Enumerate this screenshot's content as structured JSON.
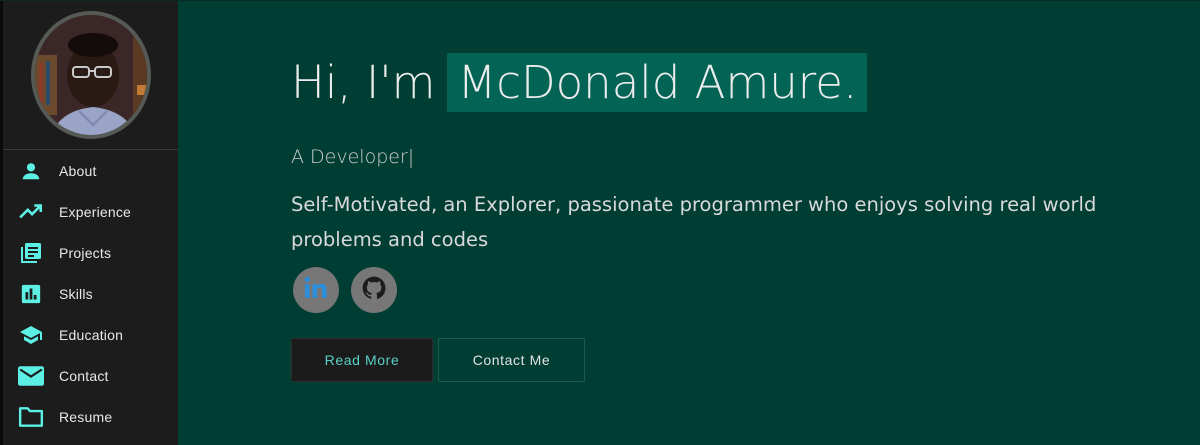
{
  "sidebar": {
    "avatar_alt": "",
    "items": [
      {
        "label": "About",
        "icon": "person-icon"
      },
      {
        "label": "Experience",
        "icon": "trending-up-icon"
      },
      {
        "label": "Projects",
        "icon": "library-books-icon"
      },
      {
        "label": "Skills",
        "icon": "bar-chart-icon"
      },
      {
        "label": "Education",
        "icon": "school-icon"
      },
      {
        "label": "Contact",
        "icon": "mail-icon"
      },
      {
        "label": "Resume",
        "icon": "folder-icon"
      }
    ]
  },
  "hero": {
    "greeting": "Hi, I'm",
    "name": "McDonald Amure.",
    "role": "A Developer|",
    "tagline": "Self-Motivated, an Explorer, passionate programmer who enjoys solving real world problems and codes"
  },
  "socials": [
    {
      "name": "linkedin",
      "icon": "linkedin-icon"
    },
    {
      "name": "github",
      "icon": "github-icon"
    }
  ],
  "buttons": {
    "read_more": "Read More",
    "contact_me": "Contact Me"
  },
  "colors": {
    "background": "#003e33",
    "sidebar": "#1c1c1c",
    "accent": "#57d1c6",
    "name_highlight": "#036455",
    "icon": "#5cefe3"
  }
}
